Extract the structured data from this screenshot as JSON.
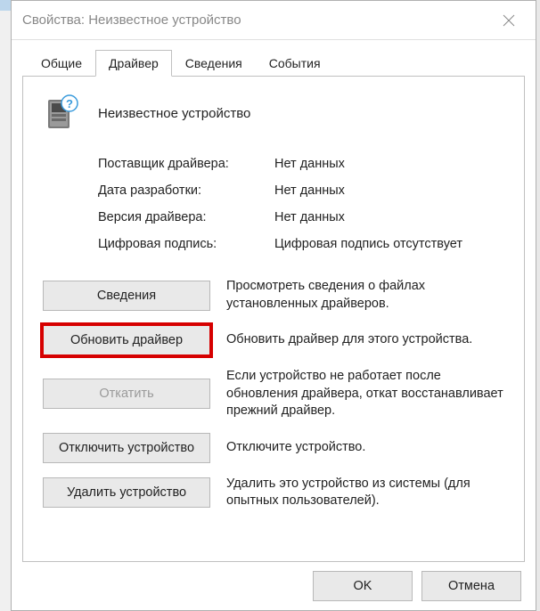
{
  "window": {
    "title": "Свойства: Неизвестное устройство"
  },
  "tabs": {
    "general": "Общие",
    "driver": "Драйвер",
    "details": "Сведения",
    "events": "События"
  },
  "device": {
    "name": "Неизвестное устройство"
  },
  "info": {
    "provider_label": "Поставщик драйвера:",
    "provider_value": "Нет данных",
    "date_label": "Дата разработки:",
    "date_value": "Нет данных",
    "version_label": "Версия драйвера:",
    "version_value": "Нет данных",
    "signer_label": "Цифровая подпись:",
    "signer_value": "Цифровая подпись отсутствует"
  },
  "actions": {
    "details_btn": "Сведения",
    "details_desc": "Просмотреть сведения о файлах установленных драйверов.",
    "update_btn": "Обновить драйвер",
    "update_desc": "Обновить драйвер для этого устройства.",
    "rollback_btn": "Откатить",
    "rollback_desc": "Если устройство не работает после обновления драйвера, откат восстанавливает прежний драйвер.",
    "disable_btn": "Отключить устройство",
    "disable_desc": "Отключите устройство.",
    "uninstall_btn": "Удалить устройство",
    "uninstall_desc": "Удалить это устройство из системы (для опытных пользователей)."
  },
  "footer": {
    "ok": "OK",
    "cancel": "Отмена"
  }
}
